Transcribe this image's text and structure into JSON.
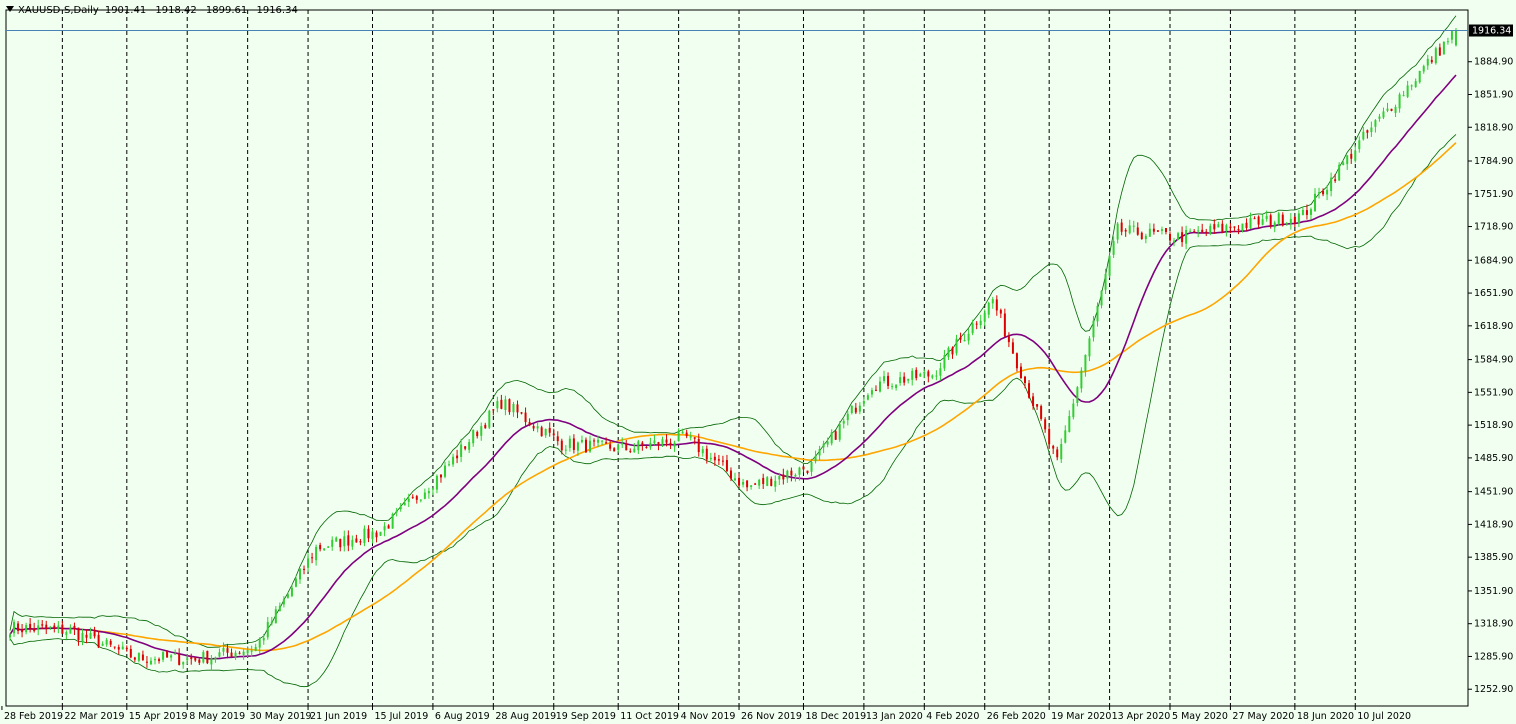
{
  "header": {
    "symbol": "XAUUSD-S,Daily",
    "open": "1901.41",
    "high": "1918.42",
    "low": "1899.61",
    "close": "1916.34"
  },
  "colors": {
    "background": "#F0FFF0",
    "bull_candle": "#32CD32",
    "bear_candle": "#DC0000",
    "ma_fast": "#800080",
    "ma_slow": "#FFA500",
    "bollinger": "#006400",
    "grid": "#000000",
    "price_line": "#4682B4",
    "price_tag": "#000000"
  },
  "chart_data": {
    "type": "candlestick",
    "symbol": "XAUUSD-S",
    "timeframe": "Daily",
    "ylim": [
      1236.0,
      1937.0
    ],
    "y_ticks": [
      "1916.34",
      "1884.90",
      "1851.90",
      "1818.90",
      "1784.90",
      "1751.90",
      "1718.90",
      "1684.90",
      "1651.90",
      "1618.90",
      "1584.90",
      "1551.90",
      "1518.90",
      "1485.90",
      "1451.90",
      "1418.90",
      "1385.90",
      "1351.90",
      "1318.90",
      "1285.90",
      "1252.90"
    ],
    "x_ticks": [
      "28 Feb 2019",
      "22 Mar 2019",
      "15 Apr 2019",
      "8 May 2019",
      "30 May 2019",
      "21 Jun 2019",
      "15 Jul 2019",
      "6 Aug 2019",
      "28 Aug 2019",
      "19 Sep 2019",
      "11 Oct 2019",
      "4 Nov 2019",
      "26 Nov 2019",
      "18 Dec 2019",
      "13 Jan 2020",
      "4 Feb 2020",
      "26 Feb 2020",
      "19 Mar 2020",
      "13 Apr 2020",
      "5 May 2020",
      "27 May 2020",
      "18 Jun 2020",
      "10 Jul 2020"
    ],
    "last_price": 1916.34,
    "price_anchors": [
      {
        "date": "28 Feb 2019",
        "price": 1315
      },
      {
        "date": "22 Mar 2019",
        "price": 1312
      },
      {
        "date": "15 Apr 2019",
        "price": 1285
      },
      {
        "date": "8 May 2019",
        "price": 1283
      },
      {
        "date": "30 May 2019",
        "price": 1295
      },
      {
        "date": "21 Jun 2019",
        "price": 1395
      },
      {
        "date": "15 Jul 2019",
        "price": 1412
      },
      {
        "date": "6 Aug 2019",
        "price": 1470
      },
      {
        "date": "28 Aug 2019",
        "price": 1542
      },
      {
        "date": "19 Sep 2019",
        "price": 1500
      },
      {
        "date": "11 Oct 2019",
        "price": 1495
      },
      {
        "date": "4 Nov 2019",
        "price": 1506
      },
      {
        "date": "26 Nov 2019",
        "price": 1456
      },
      {
        "date": "18 Dec 2019",
        "price": 1478
      },
      {
        "date": "13 Jan 2020",
        "price": 1560
      },
      {
        "date": "4 Feb 2020",
        "price": 1570
      },
      {
        "date": "26 Feb 2020",
        "price": 1645
      },
      {
        "date": "19 Mar 2020",
        "price": 1480
      },
      {
        "date": "13 Apr 2020",
        "price": 1715
      },
      {
        "date": "5 May 2020",
        "price": 1708
      },
      {
        "date": "27 May 2020",
        "price": 1720
      },
      {
        "date": "18 Jun 2020",
        "price": 1730
      },
      {
        "date": "10 Jul 2020",
        "price": 1808
      },
      {
        "date": "last",
        "price": 1916.34
      }
    ],
    "series": [
      {
        "name": "",
        "kind": "moving_average_fast",
        "color": "#800080"
      },
      {
        "name": "",
        "kind": "moving_average_slow",
        "color": "#FFA500"
      },
      {
        "name": "",
        "kind": "bollinger_bands",
        "color": "#006400"
      }
    ],
    "grid": "vertical dashed"
  }
}
